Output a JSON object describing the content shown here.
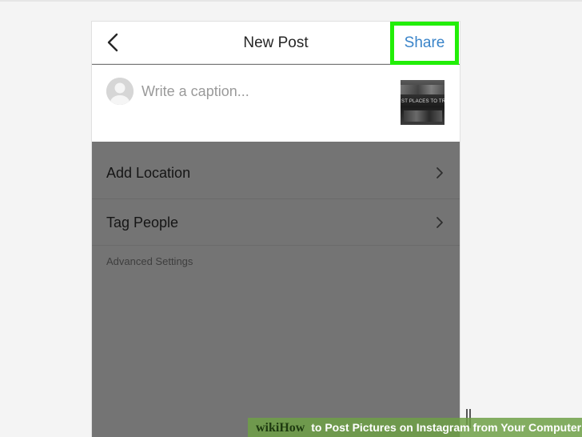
{
  "header": {
    "title": "New Post",
    "back_icon": "chevron-left-icon",
    "share_label": "Share",
    "share_color": "#3a84c9",
    "highlight_color": "#22ee08"
  },
  "caption": {
    "placeholder": "Write a caption...",
    "value": "",
    "avatar_icon": "default-avatar-icon",
    "thumbnail_text": "ST PLACES TO TRAV"
  },
  "options": {
    "add_location": "Add Location",
    "tag_people": "Tag People",
    "advanced_settings": "Advanced Settings",
    "chevron_icon": "chevron-right-icon"
  },
  "watermark": {
    "brand_prefix": "wiki",
    "brand_suffix": "How",
    "text": "to Post Pictures on Instagram from Your Computer"
  }
}
